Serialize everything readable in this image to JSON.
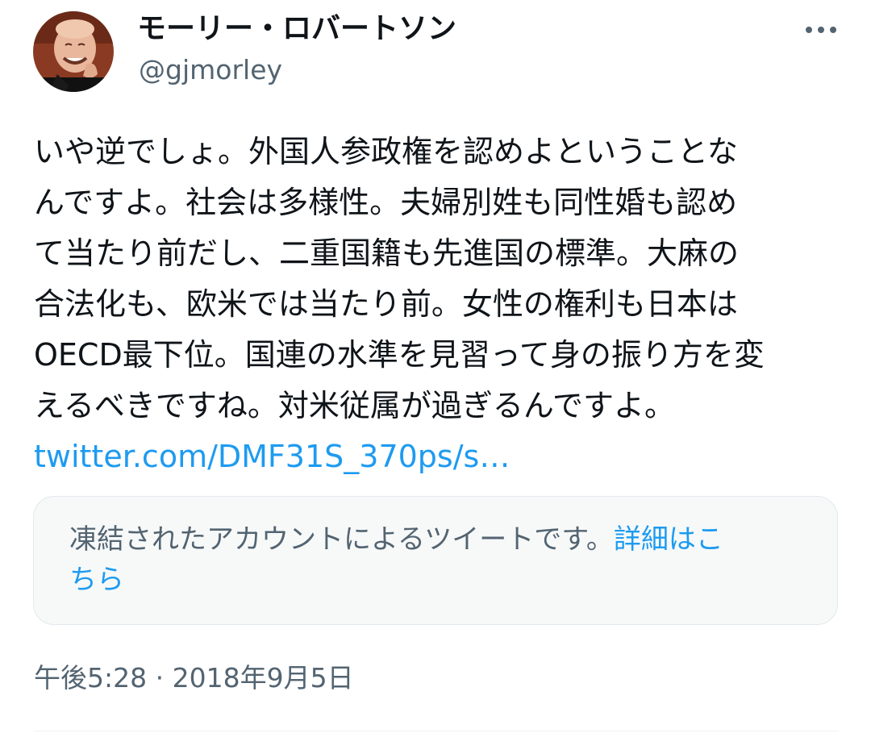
{
  "author": {
    "display_name": "モーリー・ロバートソン",
    "handle": "@gjmorley"
  },
  "menu": {
    "icon": "more-horizontal-icon"
  },
  "tweet": {
    "lines": [
      "いや逆でしょ。外国人参政権を認めよということな",
      "んですよ。社会は多様性。夫婦別姓も同性婚も認め",
      "て当たり前だし、二重国籍も先進国の標準。大麻の",
      "合法化も、欧米では当たり前。女性の権利も日本は",
      "OECD最下位。国連の水準を見習って身の振り方を変",
      "えるべきですね。対米従属が過ぎるんですよ。"
    ],
    "link_text": "twitter.com/DMF31S_370ps/s…"
  },
  "notice": {
    "text_part1": "凍結されたアカウントによるツイートです。",
    "link_part1": "詳細はこ",
    "link_part2": "ちら"
  },
  "meta": {
    "time": "午後5:28",
    "separator": " · ",
    "date": "2018年9月5日"
  },
  "colors": {
    "link": "#1d9bf0",
    "secondary_text": "#536471",
    "notice_background": "#f7f9f9"
  }
}
